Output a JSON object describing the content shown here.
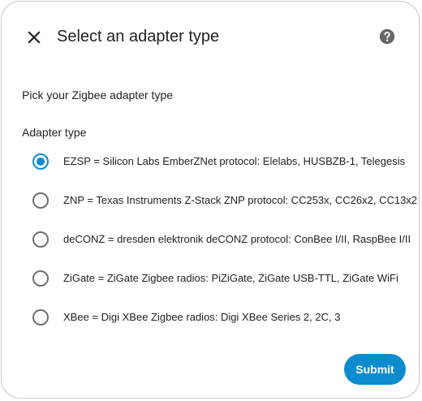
{
  "dialog": {
    "title": "Select an adapter type",
    "intro": "Pick your Zigbee adapter type",
    "group_label": "Adapter type",
    "close_icon": "close-icon",
    "help_icon": "help-circle-icon",
    "options": [
      {
        "label": "EZSP = Silicon Labs EmberZNet protocol: Elelabs, HUSBZB-1, Telegesis",
        "checked": true
      },
      {
        "label": "ZNP = Texas Instruments Z-Stack ZNP protocol: CC253x, CC26x2, CC13x2",
        "checked": false
      },
      {
        "label": "deCONZ = dresden elektronik deCONZ protocol: ConBee I/II, RaspBee I/II",
        "checked": false
      },
      {
        "label": "ZiGate = ZiGate Zigbee radios: PiZiGate, ZiGate USB-TTL, ZiGate WiFi",
        "checked": false
      },
      {
        "label": "XBee = Digi XBee Zigbee radios: Digi XBee Series 2, 2C, 3",
        "checked": false
      }
    ],
    "submit_label": "Submit"
  },
  "colors": {
    "accent": "#0b8ed1",
    "text": "#212121",
    "radio_unchecked": "#6f6f6f",
    "border": "#c8c8c8"
  }
}
